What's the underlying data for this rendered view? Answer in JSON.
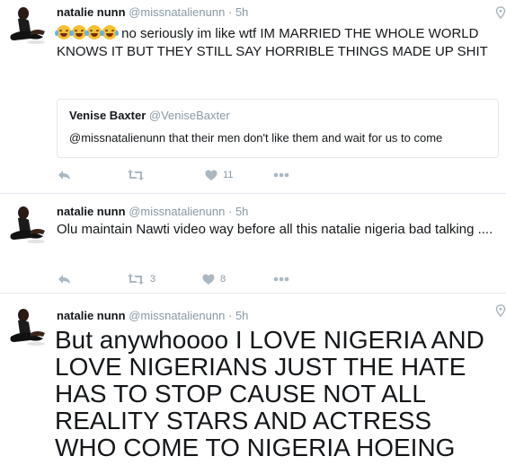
{
  "tweets": [
    {
      "name": "natalie nunn",
      "handle": "@missnatalienunn",
      "separator": "·",
      "time": "5h",
      "emoji_count": 4,
      "text": "no seriously im like wtf IM MARRIED THE WHOLE WORLD KNOWS IT BUT THEY STILL SAY HORRIBLE THINGS MADE UP SHIT",
      "quote": {
        "name": "Venise Baxter",
        "handle": "@VeniseBaxter",
        "text": "@missnatalienunn that their men don't like them and wait for us to come"
      },
      "actions": {
        "reply_icon": "reply-icon",
        "retweet_icon": "retweet-icon",
        "retweet_count": "",
        "like_icon": "heart-icon",
        "like_count": "11",
        "more_icon": "more-icon"
      }
    },
    {
      "name": "natalie nunn",
      "handle": "@missnatalienunn",
      "separator": "·",
      "time": "5h",
      "text": "Olu maintain Nawti video way before all this natalie nigeria bad talking ....",
      "actions": {
        "reply_icon": "reply-icon",
        "retweet_icon": "retweet-icon",
        "retweet_count": "3",
        "like_icon": "heart-icon",
        "like_count": "8",
        "more_icon": "more-icon"
      }
    },
    {
      "name": "natalie nunn",
      "handle": "@missnatalienunn",
      "separator": "·",
      "time": "5h",
      "text": "But anywhoooo I LOVE NIGERIA AND LOVE NIGERIANS JUST THE HATE HAS TO STOP CAUSE NOT ALL REALITY STARS AND ACTRESS WHO COME TO NIGERIA HOEING"
    }
  ],
  "colors": {
    "text": "#14171a",
    "muted": "#8899a6",
    "border": "#e1e8ed",
    "icon": "#aab8c2"
  }
}
